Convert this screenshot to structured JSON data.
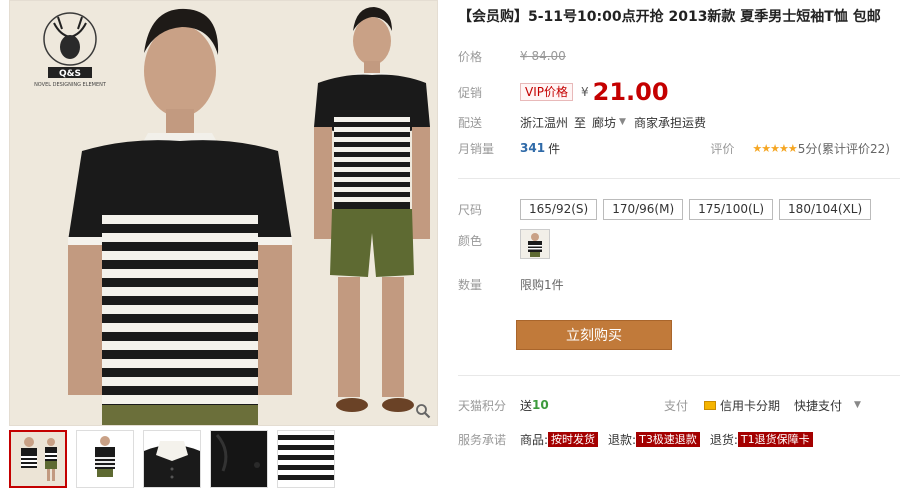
{
  "gallery": {
    "logo_text": "Q&S",
    "logo_sub": "NOVEL DESIGNING ELEMENT",
    "thumb_count": 5
  },
  "product": {
    "title": "【会员购】5-11号10:00点开抢 2013新款 夏季男士短袖T恤 包邮",
    "list_price_label": "价格",
    "list_price": "¥ 84.00",
    "promo_label": "促销",
    "vip_label": "VIP价格",
    "currency": "¥",
    "promo_price": "21.00",
    "shipping_label": "配送",
    "ship_from": "浙江温州",
    "ship_to_word": "至",
    "ship_to": "廊坊",
    "ship_note": "商家承担运费",
    "monthly_sales_label": "月销量",
    "monthly_sales": "341",
    "monthly_sales_unit": "件",
    "rating_label": "评价",
    "rating_stars": "★★★★★",
    "rating_score": "5分",
    "rating_count": "(累计评价22)"
  },
  "options": {
    "size_label": "尺码",
    "sizes": [
      "165/92(S)",
      "170/96(M)",
      "175/100(L)",
      "180/104(XL)"
    ],
    "color_label": "颜色",
    "quantity_label": "数量",
    "quantity_limit": "限购1件"
  },
  "buy_button": "立刻购买",
  "points": {
    "label": "天猫积分",
    "prefix": "送",
    "value": "10"
  },
  "payment": {
    "label": "支付",
    "credit": "信用卡分期",
    "quick": "快捷支付"
  },
  "services": {
    "label": "服务承诺",
    "goods_label": "商品:",
    "goods_tag": "按时发货",
    "refund_label": "退款:",
    "refund_tag": "T3极速退款",
    "return_label": "退货:",
    "return_tag": "T1退货保障卡"
  },
  "colors": {
    "accent": "#c40000",
    "buy": "#c17a3a",
    "green": "#3c9a3c",
    "star": "#f5a623"
  }
}
